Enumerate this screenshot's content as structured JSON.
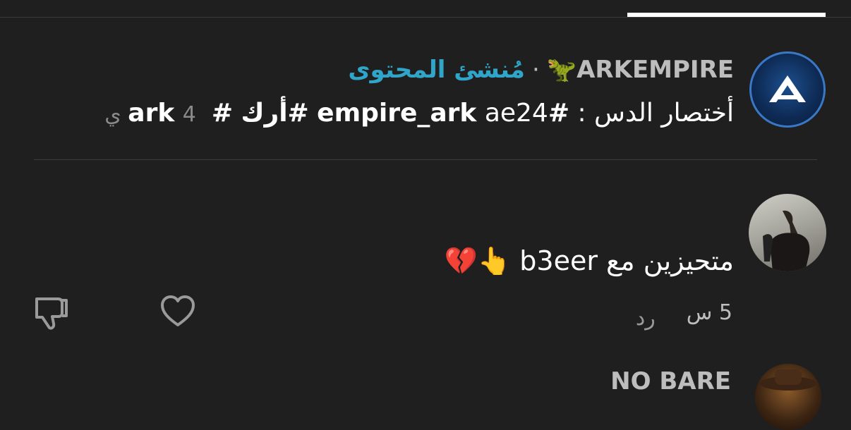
{
  "comments": [
    {
      "author": "🦖ARKEMPIRE",
      "separator": "·",
      "creator_badge": "مُنشئ المحتوى",
      "text_prefix": "أختصار الدس :",
      "tags": [
        "#empire_ark",
        "ae24",
        "#أرك",
        "#ark"
      ],
      "age": "4 ي"
    },
    {
      "text": "متحيزين مع b3eer 👆💔",
      "time": "5 س",
      "reply_label": "رد"
    },
    {
      "author": "NO BARE"
    }
  ],
  "icons": {
    "like": "heart-outline-icon",
    "dislike": "thumbs-down-outline-icon"
  },
  "colors": {
    "background": "#1f1f1f",
    "creator_badge": "#2fa6c9",
    "muted_text": "#bdbdbd"
  }
}
